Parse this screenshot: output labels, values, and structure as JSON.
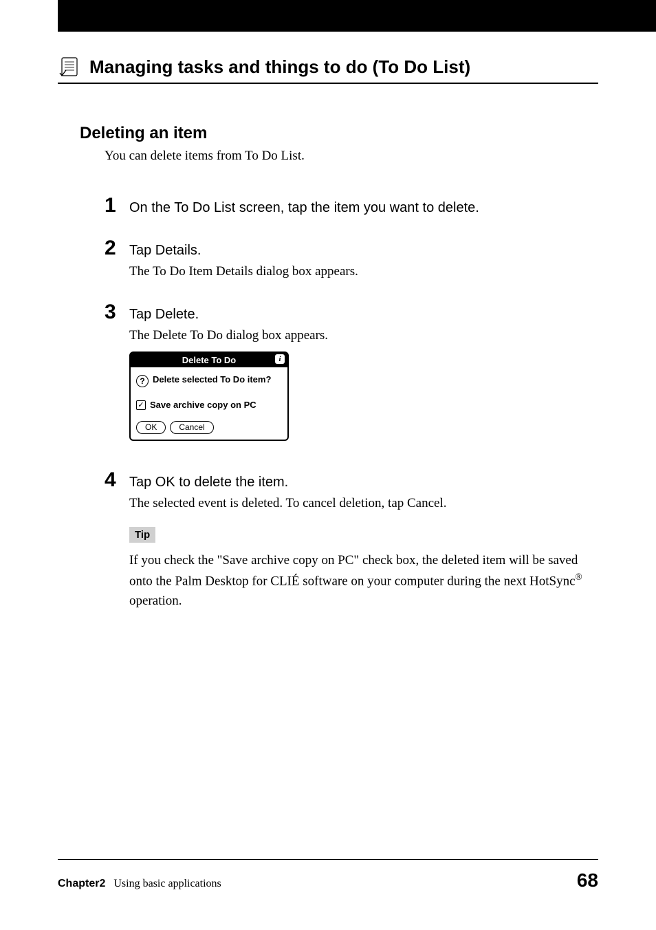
{
  "header": {
    "title": "Managing tasks and things to do (To Do List)"
  },
  "section": {
    "heading": "Deleting an item",
    "intro": "You can delete items from To Do List."
  },
  "steps": [
    {
      "num": "1",
      "text": "On the To Do List screen, tap the item you want to delete.",
      "desc": ""
    },
    {
      "num": "2",
      "text": "Tap Details.",
      "desc": "The To Do Item Details dialog box appears."
    },
    {
      "num": "3",
      "text": "Tap Delete.",
      "desc": "The Delete To Do dialog box appears."
    },
    {
      "num": "4",
      "text": "Tap OK to delete the item.",
      "desc": "The selected event is deleted. To cancel deletion, tap Cancel."
    }
  ],
  "dialog": {
    "title": "Delete To Do",
    "info_icon": "i",
    "question": "Delete selected To Do item?",
    "checkbox_label": "Save archive copy on PC",
    "ok": "OK",
    "cancel": "Cancel"
  },
  "tip": {
    "label": "Tip",
    "text_before": "If you check the \"Save archive copy on PC\" check box, the deleted item will be saved onto the Palm Desktop for CLIÉ software on your computer during the next HotSync",
    "text_after": " operation."
  },
  "footer": {
    "chapter_label": "Chapter2",
    "chapter_desc": "Using basic applications",
    "page": "68"
  }
}
